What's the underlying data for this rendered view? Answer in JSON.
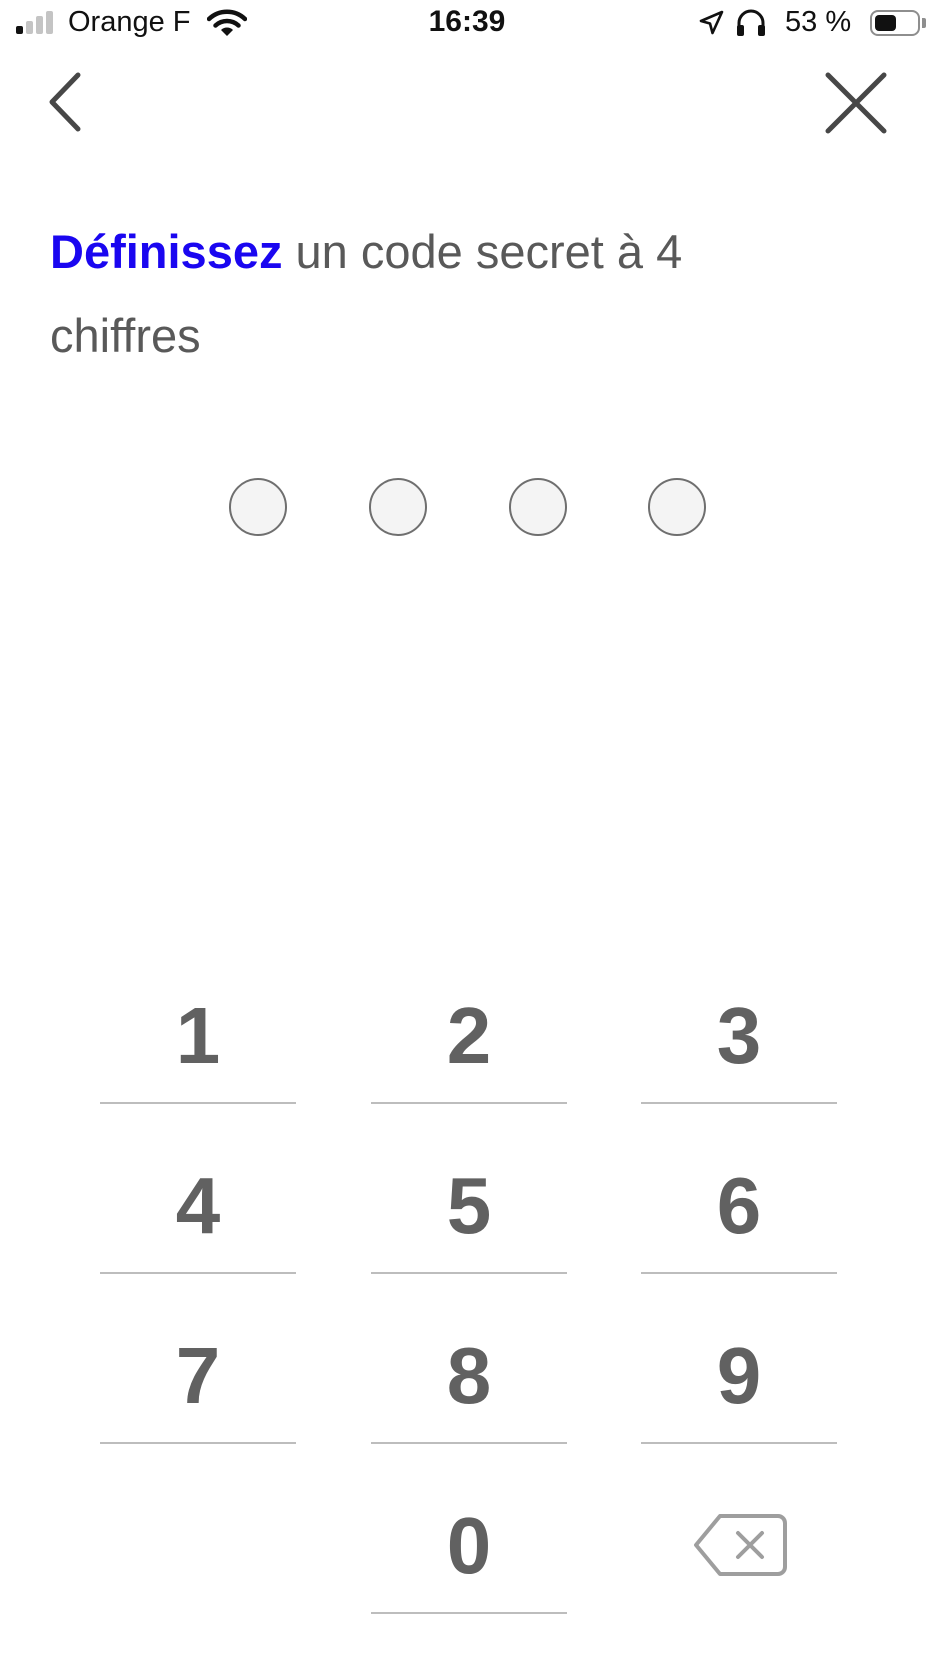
{
  "status_bar": {
    "carrier": "Orange F",
    "time": "16:39",
    "battery_percent_label": "53 %",
    "battery_level": 0.53,
    "icons": [
      "signal-icon",
      "wifi-icon",
      "location-icon",
      "headphones-icon",
      "battery-icon"
    ]
  },
  "nav": {
    "back_icon": "chevron-left-icon",
    "close_icon": "close-icon"
  },
  "heading": {
    "accent": "Définissez",
    "rest": " un code secret à 4 chiffres"
  },
  "pin": {
    "length": 4,
    "filled": 0
  },
  "keypad": {
    "keys": [
      "1",
      "2",
      "3",
      "4",
      "5",
      "6",
      "7",
      "8",
      "9",
      "0"
    ],
    "delete_icon": "backspace-icon"
  },
  "colors": {
    "accent": "#1a06f0",
    "text": "#595959",
    "key_text": "#616161",
    "divider": "#bdbdbd"
  }
}
